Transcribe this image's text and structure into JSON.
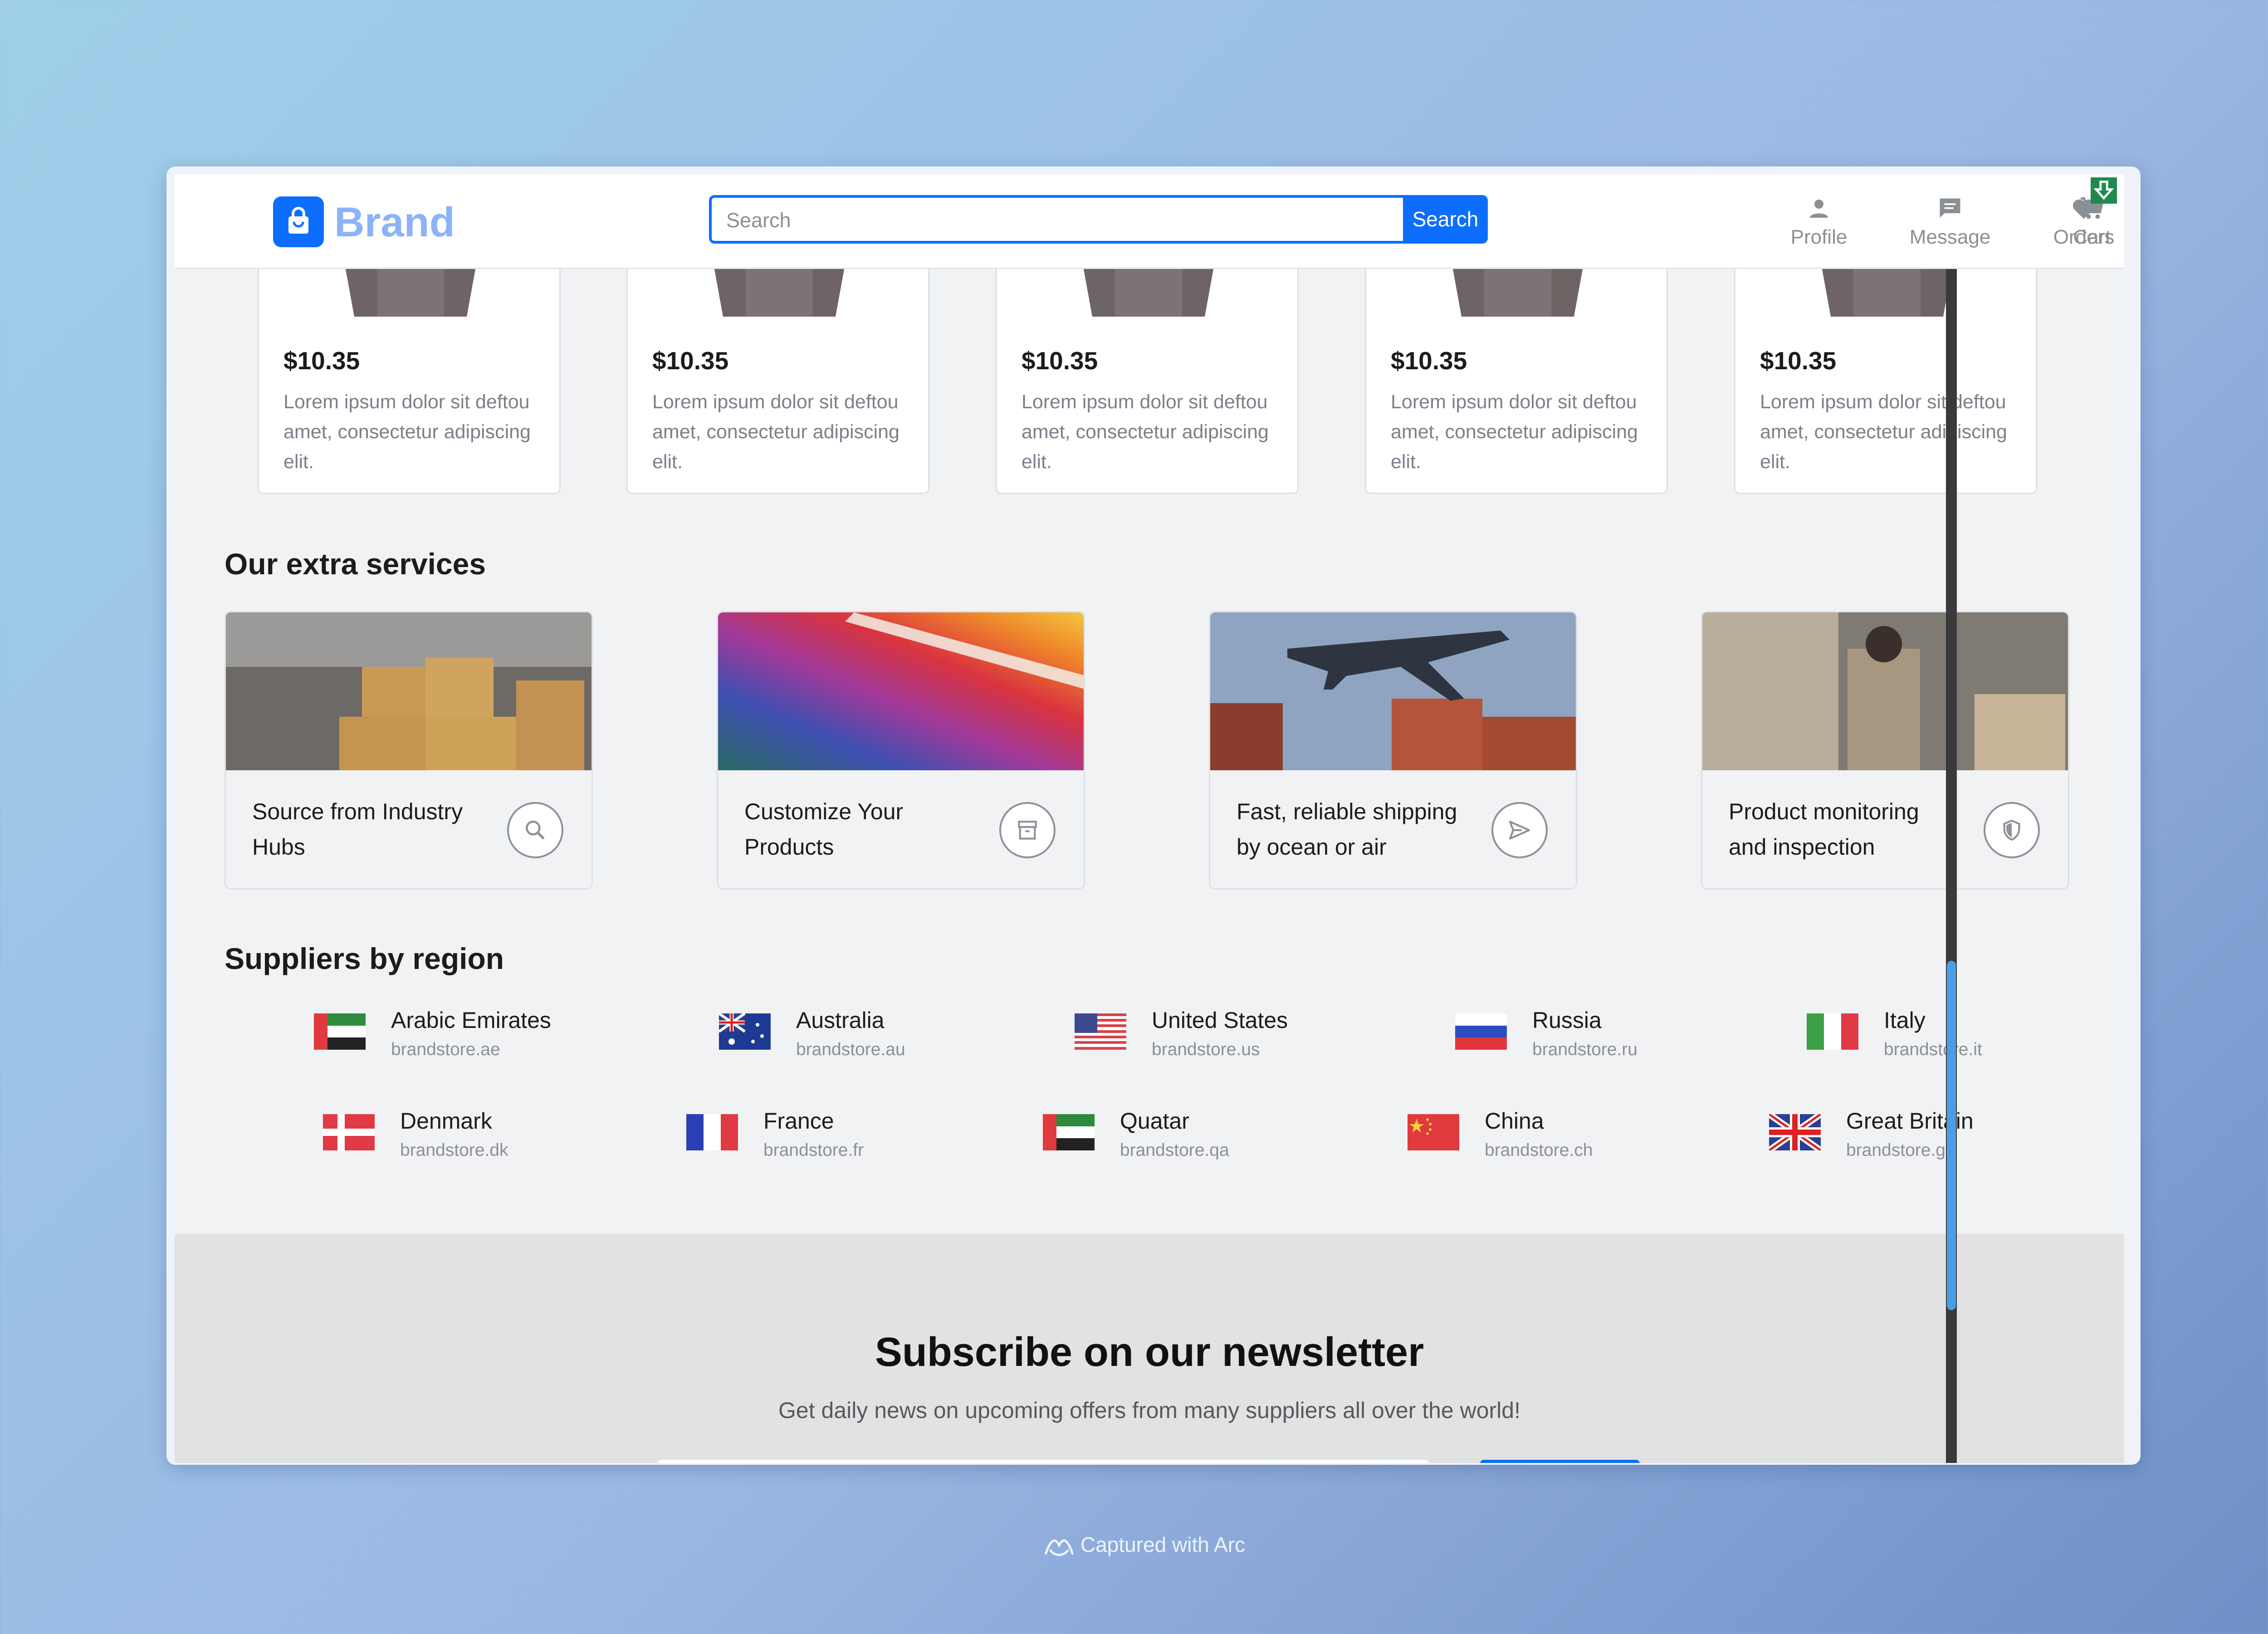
{
  "header": {
    "brand": "Brand",
    "search_placeholder": "Search",
    "search_button": "Search",
    "nav": [
      {
        "label": "Profile",
        "icon": "person-icon"
      },
      {
        "label": "Message",
        "icon": "message-icon"
      },
      {
        "label": "Orders",
        "icon": "heart-icon"
      },
      {
        "label": "Cart",
        "icon": "cart-icon"
      }
    ]
  },
  "products": [
    {
      "price": "$10.35",
      "desc": "Lorem ipsum dolor sit deftou amet, consectetur adipiscing elit."
    },
    {
      "price": "$10.35",
      "desc": "Lorem ipsum dolor sit deftou amet, consectetur adipiscing elit."
    },
    {
      "price": "$10.35",
      "desc": "Lorem ipsum dolor sit deftou amet, consectetur adipiscing elit."
    },
    {
      "price": "$10.35",
      "desc": "Lorem ipsum dolor sit deftou amet, consectetur adipiscing elit."
    },
    {
      "price": "$10.35",
      "desc": "Lorem ipsum dolor sit deftou amet, consectetur adipiscing elit."
    }
  ],
  "services": {
    "title": "Our extra services",
    "items": [
      {
        "label": "Source from Industry Hubs",
        "icon": "search-icon"
      },
      {
        "label": "Customize Your Products",
        "icon": "archive-icon"
      },
      {
        "label": "Fast, reliable shipping by ocean or air",
        "icon": "send-icon"
      },
      {
        "label": "Product monitoring and inspection",
        "icon": "shield-icon"
      }
    ]
  },
  "regions": {
    "title": "Suppliers by region",
    "items": [
      {
        "name": "Arabic Emirates",
        "site": "brandstore.ae"
      },
      {
        "name": "Australia",
        "site": "brandstore.au"
      },
      {
        "name": "United States",
        "site": "brandstore.us"
      },
      {
        "name": "Russia",
        "site": "brandstore.ru"
      },
      {
        "name": "Italy",
        "site": "brandstore.it"
      },
      {
        "name": "Denmark",
        "site": "brandstore.dk"
      },
      {
        "name": "France",
        "site": "brandstore.fr"
      },
      {
        "name": "Quatar",
        "site": "brandstore.qa"
      },
      {
        "name": "China",
        "site": "brandstore.ch"
      },
      {
        "name": "Great Britain",
        "site": "brandstore.gb"
      }
    ]
  },
  "newsletter": {
    "title": "Subscribe on our newsletter",
    "subtitle": "Get daily news on upcoming offers from many suppliers all over the world!"
  },
  "footer": {
    "capture_label": "Captured with Arc"
  },
  "colors": {
    "accent": "#0d6efd",
    "brand_text": "#8cb3f7",
    "muted": "#8b8f96"
  }
}
